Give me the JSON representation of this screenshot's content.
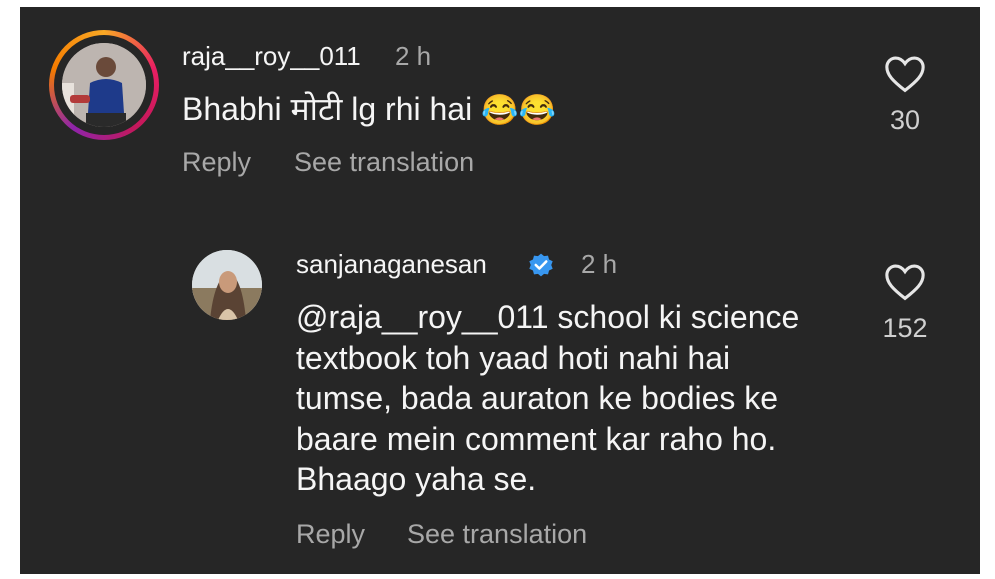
{
  "comments": [
    {
      "username": "raja__roy__011",
      "time": "2 h",
      "text": "Bhabhi मोटी lg rhi hai",
      "emoji": "😂😂",
      "likes": "30",
      "reply_label": "Reply",
      "translate_label": "See translation",
      "avatar_icon": "profile-photo"
    },
    {
      "username": "sanjanaganesan",
      "verified": true,
      "time": "2 h",
      "text_lines": [
        "@raja__roy__011 school ki science",
        "textbook toh yaad hoti nahi hai",
        "tumse, bada auraton ke bodies ke",
        "baare mein comment kar raho ho.",
        "Bhaago yaha se."
      ],
      "likes": "152",
      "reply_label": "Reply",
      "translate_label": "See translation",
      "avatar_icon": "profile-photo"
    }
  ],
  "colors": {
    "background": "#262626",
    "primary_text": "#f5f5f5",
    "secondary_text": "#a8a8a8",
    "verified_blue": "#3897f0"
  }
}
